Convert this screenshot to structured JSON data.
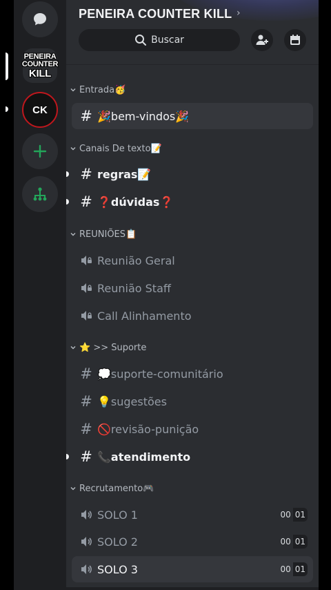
{
  "server": {
    "title": "PENEIRA COUNTER KILL",
    "logo_text_lines": [
      "PENEIRA",
      "COUNTER",
      "KILL"
    ],
    "ck_logo_text": "CK"
  },
  "search": {
    "label": "Buscar"
  },
  "categories": {
    "entrada": "Entrada🥳",
    "canais": "Canais De texto📝",
    "reunioes": "REUNIÕES📋",
    "suporte": "⭐ >> Suporte",
    "recrutamento": "Recrutamento🎮"
  },
  "channels": {
    "bem_vindos": "🎉bem-vindos🎉",
    "regras": "regras📝",
    "duvidas": "❓dúvidas❓",
    "reuniao_geral": "Reunião Geral",
    "reuniao_staff": "Reunião Staff",
    "call_alinhamento": "Call Alinhamento",
    "suporte_comunitario": "💭suporte-comunitário",
    "sugestoes": "💡sugestões",
    "revisao_punicao": "🚫revisão-punição",
    "atendimento": "📞atendimento",
    "solo1": {
      "name": "SOLO 1",
      "users": "00",
      "limit": "01"
    },
    "solo2": {
      "name": "SOLO 2",
      "users": "00",
      "limit": "01"
    },
    "solo3": {
      "name": "SOLO 3",
      "users": "00",
      "limit": "01"
    }
  },
  "icons": {
    "dm": "chat-bubble-icon",
    "add_server": "plus-icon",
    "discover": "hub-icon",
    "invite": "add-member-icon",
    "events": "calendar-icon",
    "search": "search-icon",
    "text_channel": "hash-icon",
    "voice_channel": "speaker-icon",
    "stage_channel": "locked-speaker-icon"
  },
  "colors": {
    "rail_bg": "#1e1f22",
    "panel_bg": "#2b2d31",
    "accent_green": "#23a55a",
    "ck_red": "#c0171d"
  }
}
